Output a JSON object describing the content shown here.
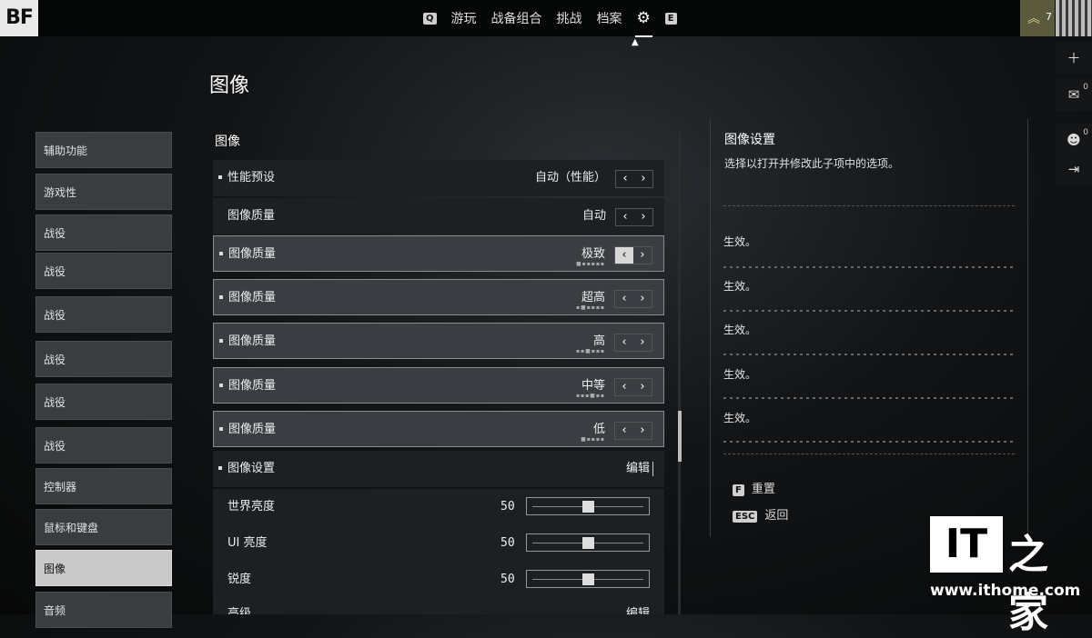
{
  "topbar": {
    "logo": "BF",
    "nav": [
      {
        "key": "Q",
        "label": "游玩"
      },
      {
        "label": "战备组合"
      },
      {
        "label": "挑战"
      },
      {
        "label": "档案"
      }
    ],
    "next_key": "E",
    "rank": "7"
  },
  "side_tools": [
    {
      "icon": "plus-icon"
    },
    {
      "icon": "mail-icon",
      "badge": "0"
    },
    {
      "icon": "friends-icon",
      "badge": "0"
    },
    {
      "icon": "exit-icon"
    }
  ],
  "page_title": "图像",
  "sidebar": {
    "items": [
      "辅助功能",
      "游戏性",
      "战役",
      "战役",
      "战役",
      "战役",
      "战役",
      "战役",
      "控制器",
      "鼠标和键盘",
      "图像",
      "音频"
    ],
    "active_index": 10
  },
  "section_label": "图像",
  "rows": [
    {
      "label": "性能预设",
      "value": "自动（性能）"
    },
    {
      "label": "图像质量",
      "value": "自动"
    },
    {
      "label": "图像质量",
      "value": "极致"
    },
    {
      "label": "图像质量",
      "value": "超高"
    },
    {
      "label": "图像质量",
      "value": "高"
    },
    {
      "label": "图像质量",
      "value": "中等"
    },
    {
      "label": "图像质量",
      "value": "低"
    },
    {
      "label": "图像设置",
      "value": "编辑"
    },
    {
      "label": "世界亮度",
      "value": "50"
    },
    {
      "label": "UI 亮度",
      "value": "50"
    },
    {
      "label": "锐度",
      "value": "50"
    },
    {
      "label": "高级",
      "value": "编辑"
    }
  ],
  "sliders": [
    0.5,
    0.5,
    0.5
  ],
  "info": {
    "title": "图像设置",
    "description": "选择以打开并修改此子项中的选项。",
    "effects": [
      "生效。",
      "生效。",
      "生效。",
      "生效。",
      "生效。"
    ],
    "reset": {
      "key": "F",
      "label": "重置"
    },
    "back": {
      "key": "ESC",
      "label": "返回"
    }
  },
  "watermark": {
    "brand": "IT",
    "zh": "之家",
    "url": "www.ithome.com"
  }
}
